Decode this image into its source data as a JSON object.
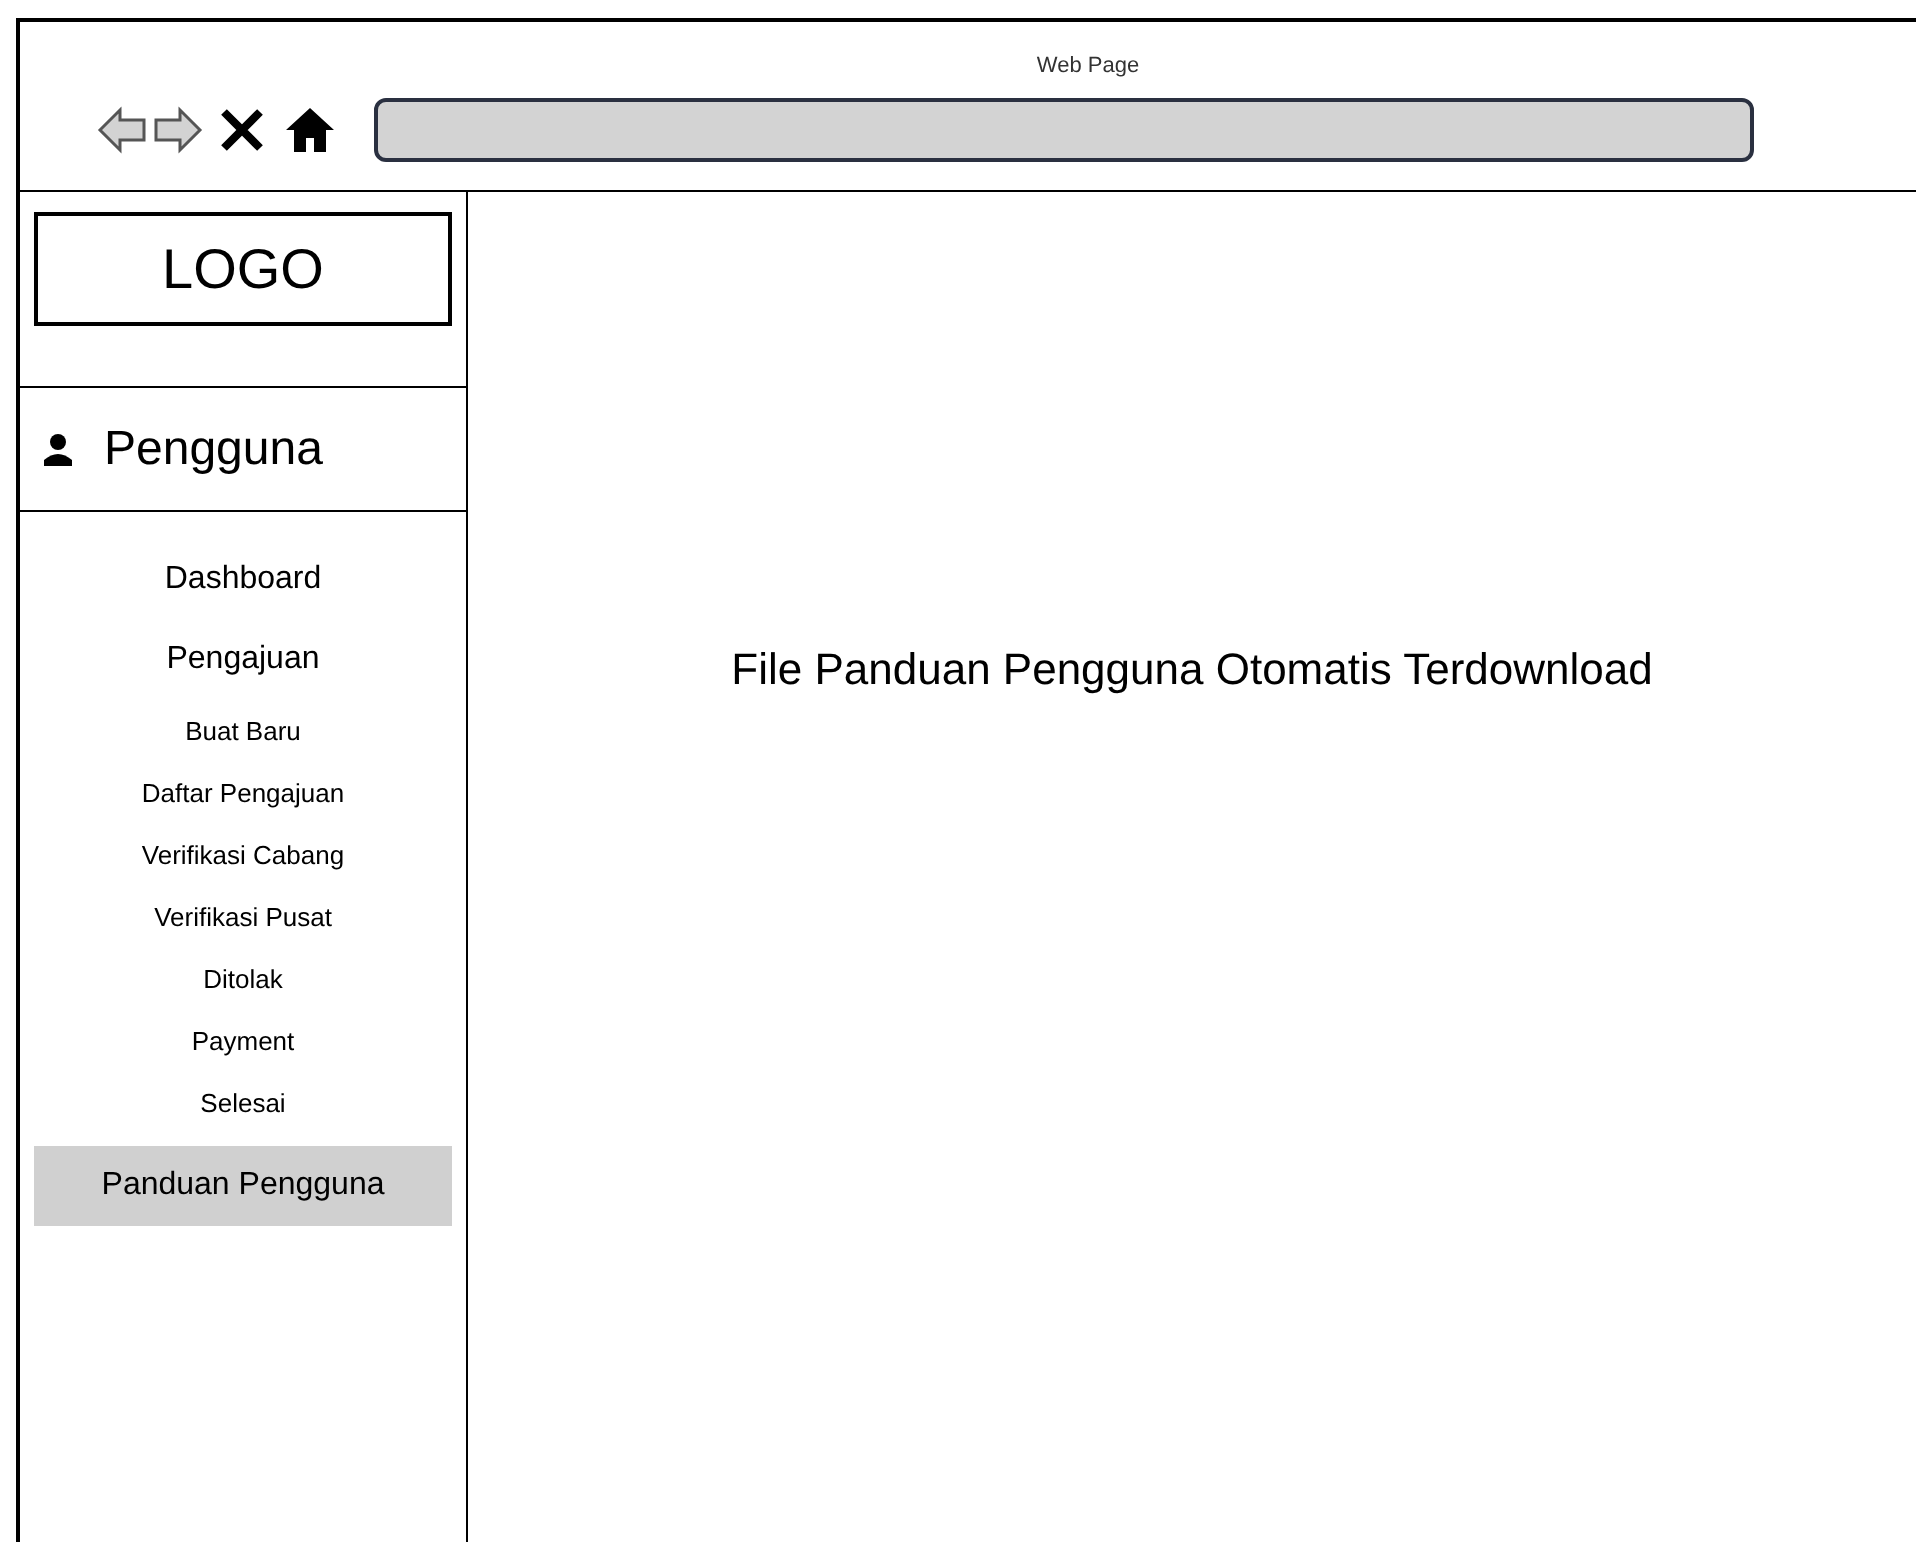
{
  "window": {
    "title": "Web Page"
  },
  "sidebar": {
    "logo": "LOGO",
    "user": "Pengguna",
    "items": [
      {
        "label": "Dashboard",
        "kind": "main",
        "selected": false
      },
      {
        "label": "Pengajuan",
        "kind": "main",
        "selected": false
      },
      {
        "label": "Buat Baru",
        "kind": "sub",
        "selected": false
      },
      {
        "label": "Daftar Pengajuan",
        "kind": "sub",
        "selected": false
      },
      {
        "label": "Verifikasi Cabang",
        "kind": "sub",
        "selected": false
      },
      {
        "label": "Verifikasi Pusat",
        "kind": "sub",
        "selected": false
      },
      {
        "label": "Ditolak",
        "kind": "sub",
        "selected": false
      },
      {
        "label": "Payment",
        "kind": "sub",
        "selected": false
      },
      {
        "label": "Selesai",
        "kind": "sub",
        "selected": false
      },
      {
        "label": "Panduan Pengguna",
        "kind": "main",
        "selected": true
      }
    ]
  },
  "main": {
    "message": "File Panduan Pengguna Otomatis Terdownload"
  }
}
